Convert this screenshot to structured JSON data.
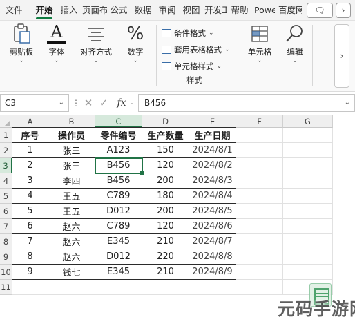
{
  "tabs": [
    "文件",
    "开始",
    "插入",
    "页面布局",
    "公式",
    "数据",
    "审阅",
    "视图",
    "开发工具",
    "帮助",
    "Power Pivot",
    "百度网盘"
  ],
  "active_tab": "开始",
  "ribbon": {
    "clipboard_label": "剪贴板",
    "font_label": "字体",
    "align_label": "对齐方式",
    "number_label": "数字",
    "number_glyph": "%",
    "font_glyph": "A",
    "cond_format": "条件格式",
    "table_format": "套用表格格式",
    "cell_styles": "单元格样式",
    "styles_group": "样式",
    "cells_label": "单元格",
    "edit_label": "编辑",
    "drop_glyph": "⌄",
    "scroll_glyph": "›"
  },
  "window": {
    "comment_glyph": "🗨",
    "more_glyph": "›"
  },
  "formula_bar": {
    "name_box": "C3",
    "formula": "B456",
    "cancel_glyph": "✕",
    "enter_glyph": "✓",
    "fx_glyph": "fx",
    "dropdown_glyph": "⌄",
    "dots_glyph": "⋮"
  },
  "grid": {
    "columns": [
      "A",
      "B",
      "C",
      "D",
      "E",
      "F",
      "G"
    ],
    "rows": [
      "1",
      "2",
      "3",
      "4",
      "5",
      "6",
      "7",
      "8",
      "9",
      "10",
      "11"
    ],
    "header": [
      "序号",
      "操作员",
      "零件编号",
      "生产数量",
      "生产日期"
    ],
    "data": [
      [
        "1",
        "张三",
        "A123",
        "150",
        "2024/8/1"
      ],
      [
        "2",
        "张三",
        "B456",
        "120",
        "2024/8/2"
      ],
      [
        "3",
        "李四",
        "B456",
        "200",
        "2024/8/3"
      ],
      [
        "4",
        "王五",
        "C789",
        "180",
        "2024/8/4"
      ],
      [
        "5",
        "王五",
        "D012",
        "200",
        "2024/8/5"
      ],
      [
        "6",
        "赵六",
        "C789",
        "120",
        "2024/8/6"
      ],
      [
        "7",
        "赵六",
        "E345",
        "210",
        "2024/8/7"
      ],
      [
        "8",
        "赵六",
        "D012",
        "220",
        "2024/8/8"
      ],
      [
        "9",
        "钱七",
        "E345",
        "210",
        "2024/8/9"
      ]
    ],
    "selected_cell": "C3"
  },
  "watermark": "元码手游网",
  "colors": {
    "accent": "#217346",
    "tab_underline": "#107c41"
  }
}
